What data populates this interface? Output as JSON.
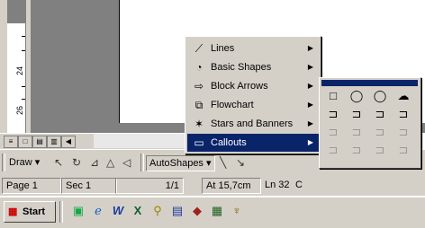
{
  "ruler": {
    "labels": [
      "24",
      "26"
    ]
  },
  "view_buttons": [
    "≡",
    "□",
    "▤",
    "▥"
  ],
  "draw_toolbar": {
    "draw_label": "Draw",
    "autoshapes_label": "AutoShapes"
  },
  "menu": {
    "items": [
      {
        "label": "Lines",
        "icon": "lines-icon",
        "glyph": "⟋"
      },
      {
        "label": "Basic Shapes",
        "icon": "basic-shapes-icon",
        "glyph": "◔"
      },
      {
        "label": "Block Arrows",
        "icon": "block-arrows-icon",
        "glyph": "⇨"
      },
      {
        "label": "Flowchart",
        "icon": "flowchart-icon",
        "glyph": "⧉"
      },
      {
        "label": "Stars and Banners",
        "icon": "stars-banners-icon",
        "glyph": "✶"
      },
      {
        "label": "Callouts",
        "icon": "callouts-icon",
        "glyph": "▭"
      }
    ],
    "selected": "Callouts"
  },
  "submenu": {
    "rows": [
      [
        "□",
        "◯",
        "◯",
        "☁"
      ],
      [
        "⊐",
        "⊐",
        "⊐",
        "⊐"
      ],
      [
        "⊐",
        "⊐",
        "⊐",
        "⊐"
      ],
      [
        "⊐",
        "⊐",
        "⊐",
        "⊐"
      ],
      [
        "⊐",
        "⊐",
        "⊐",
        "⊐"
      ]
    ]
  },
  "status": {
    "page": "Page 1",
    "section": "Sec 1",
    "pages": "1/1",
    "at": "At 15,7cm",
    "ln": "Ln 32",
    "col": "C"
  },
  "taskbar": {
    "start_label": "Start"
  }
}
